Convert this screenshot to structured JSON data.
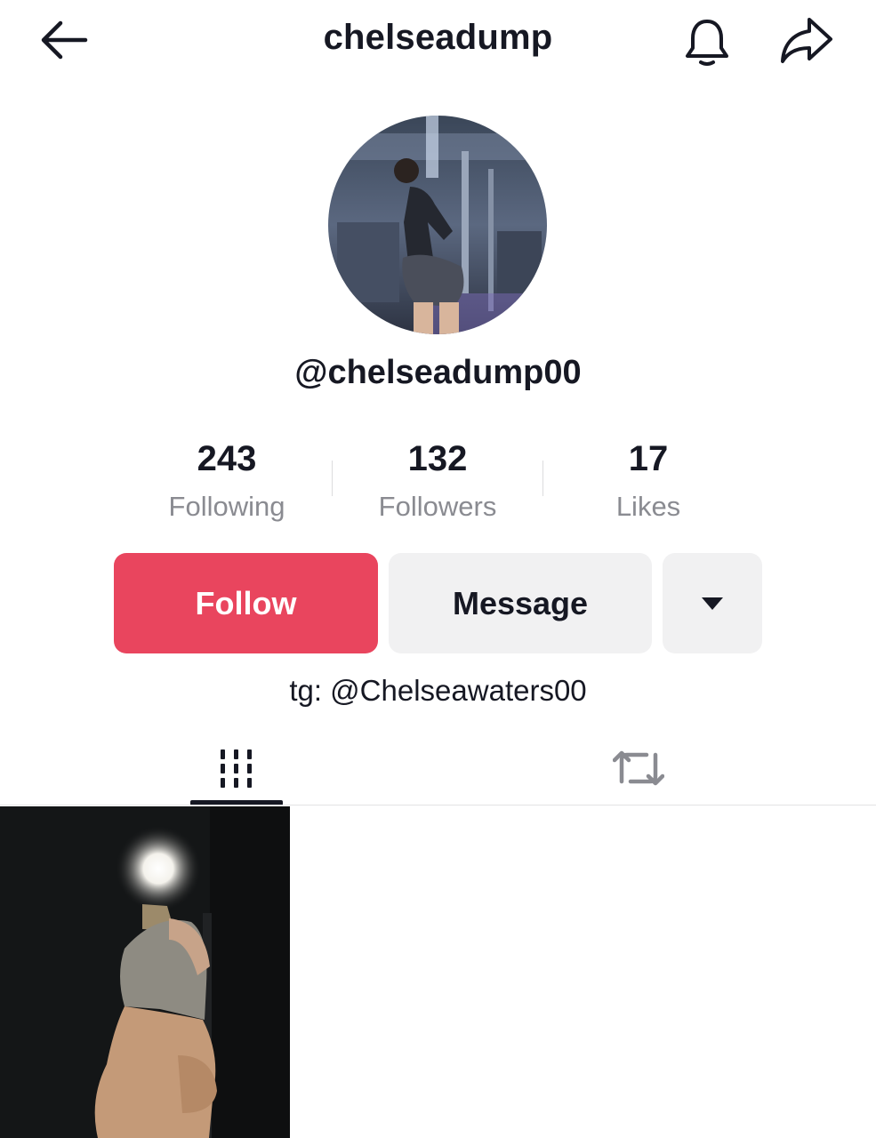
{
  "header": {
    "title": "chelseadump",
    "back_icon": "arrow-left-icon",
    "notification_icon": "bell-icon",
    "share_icon": "share-arrow-icon"
  },
  "profile": {
    "username": "@chelseadump00",
    "bio": "tg: @Chelseawaters00"
  },
  "stats": {
    "following": {
      "value": "243",
      "label": "Following"
    },
    "followers": {
      "value": "132",
      "label": "Followers"
    },
    "likes": {
      "value": "17",
      "label": "Likes"
    }
  },
  "actions": {
    "follow_label": "Follow",
    "message_label": "Message",
    "more_icon": "caret-down-icon"
  },
  "tabs": [
    {
      "icon": "grid-icon",
      "selected": true
    },
    {
      "icon": "repost-icon",
      "selected": false
    }
  ],
  "colors": {
    "follow_button": "#e9455e",
    "secondary_button": "#f1f1f2",
    "muted_text": "#8a8b91",
    "primary_text": "#161823"
  }
}
